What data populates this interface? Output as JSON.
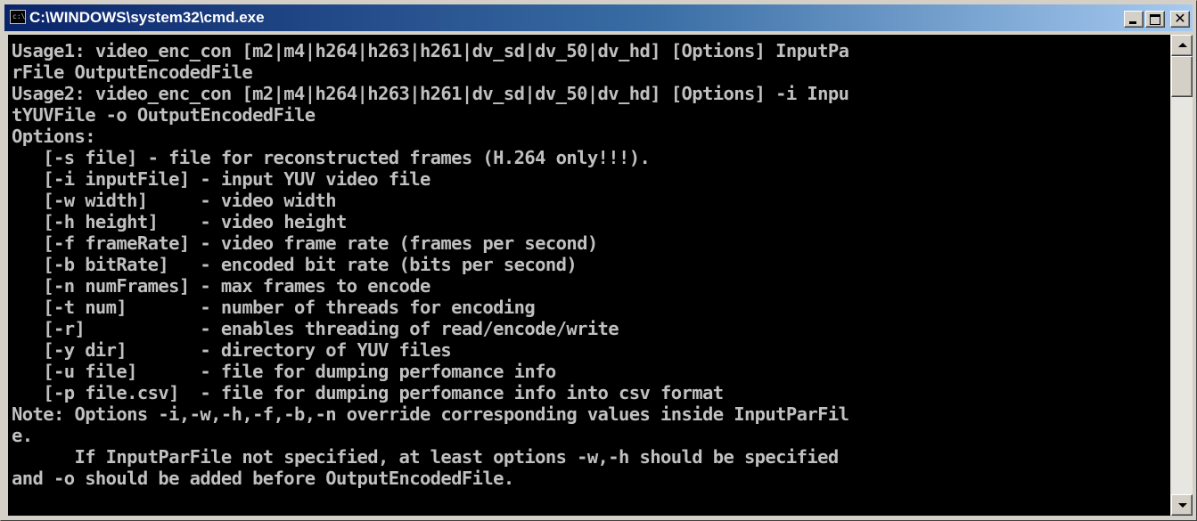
{
  "window": {
    "title": "C:\\WINDOWS\\system32\\cmd.exe",
    "icon_text": "c:\\"
  },
  "titlebar_buttons": {
    "minimize_icon": "minimize-icon",
    "maximize_icon": "maximize-icon",
    "close_icon": "close-icon",
    "close_glyph": "✕"
  },
  "console": {
    "text_color": "#c0c0c0",
    "background_color": "#000000",
    "lines": [
      "Usage1: video_enc_con [m2|m4|h264|h263|h261|dv_sd|dv_50|dv_hd] [Options] InputPa",
      "rFile OutputEncodedFile",
      "Usage2: video_enc_con [m2|m4|h264|h263|h261|dv_sd|dv_50|dv_hd] [Options] -i Inpu",
      "tYUVFile -o OutputEncodedFile",
      "Options:",
      "   [-s file] - file for reconstructed frames (H.264 only!!!).",
      "   [-i inputFile] - input YUV video file",
      "   [-w width]     - video width",
      "   [-h height]    - video height",
      "   [-f frameRate] - video frame rate (frames per second)",
      "   [-b bitRate]   - encoded bit rate (bits per second)",
      "   [-n numFrames] - max frames to encode",
      "   [-t num]       - number of threads for encoding",
      "   [-r]           - enables threading of read/encode/write",
      "   [-y dir]       - directory of YUV files",
      "   [-u file]      - file for dumping perfomance info",
      "   [-p file.csv]  - file for dumping perfomance info into csv format",
      "Note: Options -i,-w,-h,-f,-b,-n override corresponding values inside InputParFil",
      "e.",
      "      If InputParFile not specified, at least options -w,-h should be specified",
      "and -o should be added before OutputEncodedFile.",
      ""
    ]
  },
  "scrollbar": {
    "up_icon": "scroll-up-arrow-icon",
    "down_icon": "scroll-down-arrow-icon"
  }
}
